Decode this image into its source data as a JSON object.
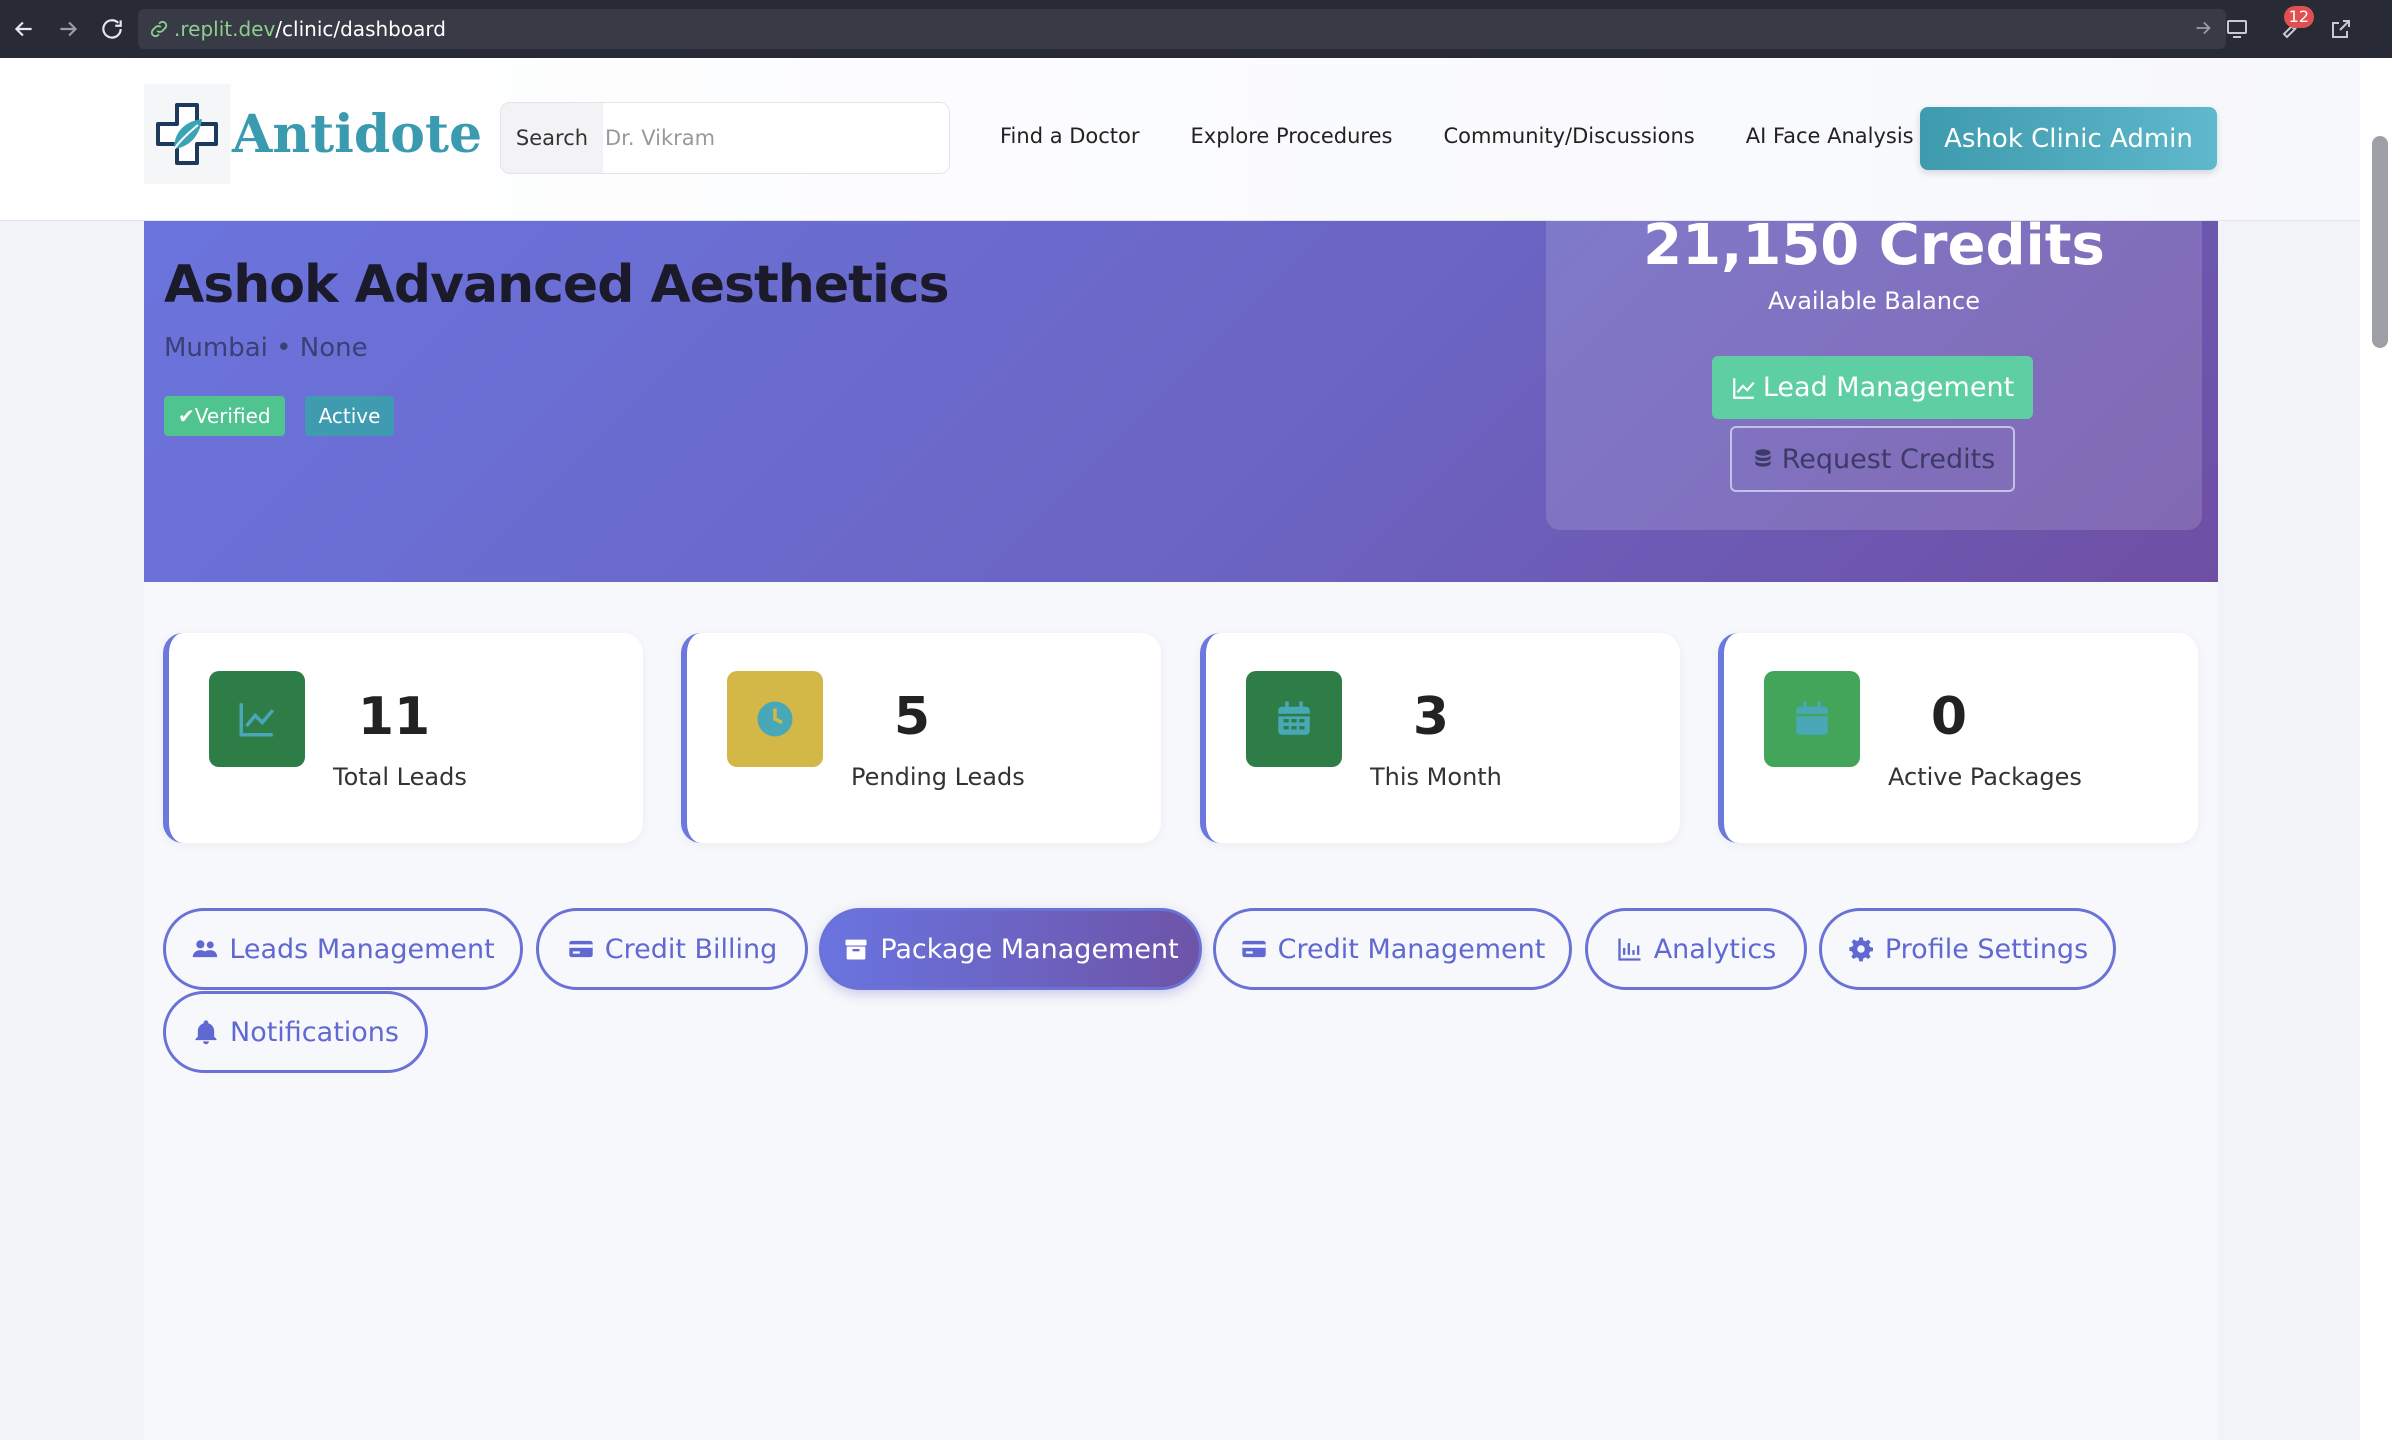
{
  "browser": {
    "url_domain": ".replit.dev",
    "url_path": "/clinic/dashboard",
    "notification_count": "12"
  },
  "header": {
    "brand": "Antidote",
    "search_label": "Search",
    "search_placeholder": "Dr. Vikram",
    "nav": [
      "Find a Doctor",
      "Explore Procedures",
      "Community/Discussions",
      "AI Face Analysis"
    ],
    "admin_button": "Ashok Clinic Admin"
  },
  "clinic": {
    "name": "Ashok Advanced Aesthetics",
    "location": "Mumbai • None",
    "badge_verified": "✔Verified",
    "badge_status": "Active"
  },
  "credits": {
    "amount": "21,150 Credits",
    "caption": "Available Balance",
    "lead_button": "Lead Management",
    "request_button": "Request Credits"
  },
  "stats": [
    {
      "value": "11",
      "label": "Total Leads",
      "icon": "chart-line-icon",
      "color": "#2e7d46"
    },
    {
      "value": "5",
      "label": "Pending Leads",
      "icon": "clock-icon",
      "color": "#d4b847"
    },
    {
      "value": "3",
      "label": "This Month",
      "icon": "calendar-icon",
      "color": "#2e7d46"
    },
    {
      "value": "0",
      "label": "Active Packages",
      "icon": "calendar-icon",
      "color": "#43a55a"
    }
  ],
  "tabs": [
    {
      "label": "Leads Management",
      "icon": "users-icon",
      "active": false
    },
    {
      "label": "Credit Billing",
      "icon": "credit-card-icon",
      "active": false
    },
    {
      "label": "Package Management",
      "icon": "box-icon",
      "active": true
    },
    {
      "label": "Credit Management",
      "icon": "credit-card-icon",
      "active": false
    },
    {
      "label": "Analytics",
      "icon": "bar-chart-icon",
      "active": false
    },
    {
      "label": "Profile Settings",
      "icon": "gear-icon",
      "active": false
    },
    {
      "label": "Notifications",
      "icon": "bell-icon",
      "active": false
    }
  ],
  "colors": {
    "accent": "#6a72d6",
    "brand": "#3a9bb0",
    "verified": "#4fc490",
    "lead_button": "#5ecfa2"
  }
}
